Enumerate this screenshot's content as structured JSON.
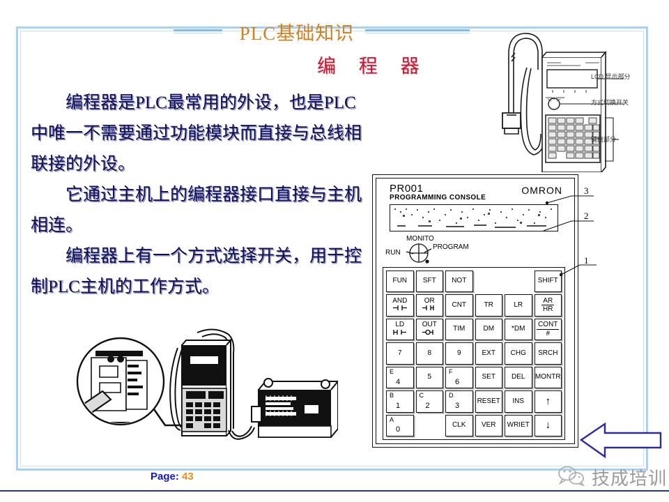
{
  "header": {
    "title": "PLC基础知识",
    "subtitle": "编 程 器"
  },
  "body": {
    "paragraphs": [
      "编程器是PLC最常用的外设，也是PLC中唯一不需要通过功能模块而直接与总线相联接的外设。",
      "它通过主机上的编程器接口直接与主机相连。",
      "编程器上有一个方式选择开关，用于控制PLC主机的工作方式。"
    ]
  },
  "device_labels": {
    "lcd": "LCD 显示部分",
    "mode_switch": "方式切换开关",
    "keyboard": "键盘部分"
  },
  "console": {
    "model": "PR001",
    "subtitle": "PROGRAMMING CONSOLE",
    "brand": "OMRON",
    "switch": {
      "run": "RUN",
      "monitor": "MONITO",
      "program": "PROGRAM"
    },
    "keys": [
      [
        {
          "label": "FUN"
        },
        {
          "label": "SFT"
        },
        {
          "label": "NOT"
        },
        {
          "label": ""
        },
        {
          "label": ""
        },
        {
          "label": "SHIFT"
        }
      ],
      [
        {
          "label": "AND",
          "symbol": "contact-no"
        },
        {
          "label": "OR",
          "symbol": "contact-or"
        },
        {
          "label": "CNT"
        },
        {
          "label": "TR"
        },
        {
          "label": "LR"
        },
        {
          "label": "AR",
          "label2": "HR",
          "style": "fraction"
        }
      ],
      [
        {
          "label": "LD",
          "symbol": "contact-ld"
        },
        {
          "label": "OUT",
          "symbol": "coil"
        },
        {
          "label": "TIM"
        },
        {
          "label": "DM"
        },
        {
          "label": "*DM"
        },
        {
          "label": "CONT",
          "label2": "#",
          "style": "fraction"
        }
      ],
      [
        {
          "label": "7"
        },
        {
          "label": "8"
        },
        {
          "label": "9"
        },
        {
          "label": "EXT"
        },
        {
          "label": "CHG"
        },
        {
          "label": "SRCH"
        }
      ],
      [
        {
          "label": "E",
          "label2": "4",
          "style": "hex"
        },
        {
          "label": "5"
        },
        {
          "label": "F",
          "label2": "6",
          "style": "hex"
        },
        {
          "label": "SET"
        },
        {
          "label": "DEL"
        },
        {
          "label": "MONTR"
        }
      ],
      [
        {
          "label": "B",
          "label2": "1",
          "style": "hex"
        },
        {
          "label": "C",
          "label2": "2",
          "style": "hex"
        },
        {
          "label": "D",
          "label2": "3",
          "style": "hex"
        },
        {
          "label": "RESET"
        },
        {
          "label": "INS"
        },
        {
          "label": "↑",
          "style": "arrow"
        }
      ],
      [
        {
          "label": "A",
          "label2": "0",
          "style": "hex"
        },
        {
          "label": ""
        },
        {
          "label": "CLK"
        },
        {
          "label": "VER"
        },
        {
          "label": "WRIET"
        },
        {
          "label": "↓",
          "style": "arrow"
        }
      ]
    ],
    "callouts": [
      "3",
      "2",
      "1"
    ]
  },
  "footer": {
    "page_label": "Page:",
    "page_number": "43",
    "brand_text": "技成培训"
  },
  "colors": {
    "title": "#d4801f",
    "subtitle": "#c21b35",
    "body": "#10104a",
    "frame": "#a8d2f5",
    "page_label": "#1414c8",
    "page_number": "#f28c16",
    "arrow": "#2a2aa8"
  }
}
